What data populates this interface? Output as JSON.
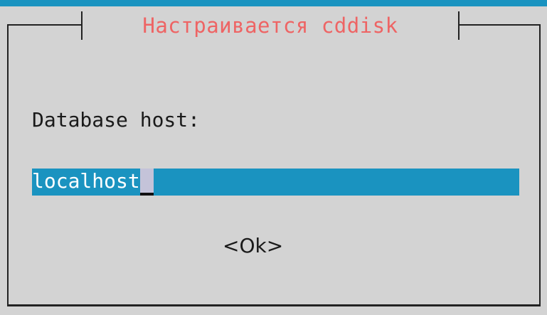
{
  "dialog": {
    "title": "Настраивается cddisk",
    "prompt": "Database host:",
    "input": {
      "value": "localhost"
    },
    "ok_label": "<Ok>"
  },
  "colors": {
    "background": "#d3d3d3",
    "title": "#ee6464",
    "input_highlight": "#1a93c0",
    "text": "#1a1a1a",
    "cursor": "#c4c3d9"
  }
}
